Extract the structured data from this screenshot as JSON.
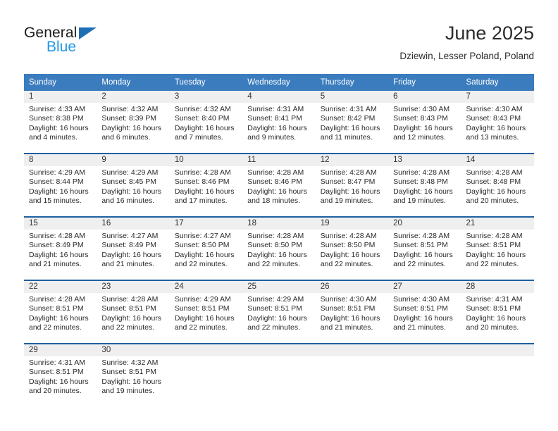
{
  "brand": {
    "line1": "General",
    "line2": "Blue",
    "triangle_color": "#1f6fb5",
    "blue_text_color": "#2196e3"
  },
  "header": {
    "title": "June 2025",
    "subtitle": "Dziewin, Lesser Poland, Poland"
  },
  "colors": {
    "header_band": "#3a7cbe",
    "row_divider": "#1f5fa0",
    "daynum_band": "#efefef",
    "text": "#2a2a2a"
  },
  "weekdays": [
    "Sunday",
    "Monday",
    "Tuesday",
    "Wednesday",
    "Thursday",
    "Friday",
    "Saturday"
  ],
  "labels": {
    "sunrise_prefix": "Sunrise:",
    "sunset_prefix": "Sunset:",
    "daylight_prefix": "Daylight:"
  },
  "weeks": [
    [
      {
        "day": "1",
        "sunrise": "Sunrise: 4:33 AM",
        "sunset": "Sunset: 8:38 PM",
        "daylight": "Daylight: 16 hours and 4 minutes."
      },
      {
        "day": "2",
        "sunrise": "Sunrise: 4:32 AM",
        "sunset": "Sunset: 8:39 PM",
        "daylight": "Daylight: 16 hours and 6 minutes."
      },
      {
        "day": "3",
        "sunrise": "Sunrise: 4:32 AM",
        "sunset": "Sunset: 8:40 PM",
        "daylight": "Daylight: 16 hours and 7 minutes."
      },
      {
        "day": "4",
        "sunrise": "Sunrise: 4:31 AM",
        "sunset": "Sunset: 8:41 PM",
        "daylight": "Daylight: 16 hours and 9 minutes."
      },
      {
        "day": "5",
        "sunrise": "Sunrise: 4:31 AM",
        "sunset": "Sunset: 8:42 PM",
        "daylight": "Daylight: 16 hours and 11 minutes."
      },
      {
        "day": "6",
        "sunrise": "Sunrise: 4:30 AM",
        "sunset": "Sunset: 8:43 PM",
        "daylight": "Daylight: 16 hours and 12 minutes."
      },
      {
        "day": "7",
        "sunrise": "Sunrise: 4:30 AM",
        "sunset": "Sunset: 8:43 PM",
        "daylight": "Daylight: 16 hours and 13 minutes."
      }
    ],
    [
      {
        "day": "8",
        "sunrise": "Sunrise: 4:29 AM",
        "sunset": "Sunset: 8:44 PM",
        "daylight": "Daylight: 16 hours and 15 minutes."
      },
      {
        "day": "9",
        "sunrise": "Sunrise: 4:29 AM",
        "sunset": "Sunset: 8:45 PM",
        "daylight": "Daylight: 16 hours and 16 minutes."
      },
      {
        "day": "10",
        "sunrise": "Sunrise: 4:28 AM",
        "sunset": "Sunset: 8:46 PM",
        "daylight": "Daylight: 16 hours and 17 minutes."
      },
      {
        "day": "11",
        "sunrise": "Sunrise: 4:28 AM",
        "sunset": "Sunset: 8:46 PM",
        "daylight": "Daylight: 16 hours and 18 minutes."
      },
      {
        "day": "12",
        "sunrise": "Sunrise: 4:28 AM",
        "sunset": "Sunset: 8:47 PM",
        "daylight": "Daylight: 16 hours and 19 minutes."
      },
      {
        "day": "13",
        "sunrise": "Sunrise: 4:28 AM",
        "sunset": "Sunset: 8:48 PM",
        "daylight": "Daylight: 16 hours and 19 minutes."
      },
      {
        "day": "14",
        "sunrise": "Sunrise: 4:28 AM",
        "sunset": "Sunset: 8:48 PM",
        "daylight": "Daylight: 16 hours and 20 minutes."
      }
    ],
    [
      {
        "day": "15",
        "sunrise": "Sunrise: 4:28 AM",
        "sunset": "Sunset: 8:49 PM",
        "daylight": "Daylight: 16 hours and 21 minutes."
      },
      {
        "day": "16",
        "sunrise": "Sunrise: 4:27 AM",
        "sunset": "Sunset: 8:49 PM",
        "daylight": "Daylight: 16 hours and 21 minutes."
      },
      {
        "day": "17",
        "sunrise": "Sunrise: 4:27 AM",
        "sunset": "Sunset: 8:50 PM",
        "daylight": "Daylight: 16 hours and 22 minutes."
      },
      {
        "day": "18",
        "sunrise": "Sunrise: 4:28 AM",
        "sunset": "Sunset: 8:50 PM",
        "daylight": "Daylight: 16 hours and 22 minutes."
      },
      {
        "day": "19",
        "sunrise": "Sunrise: 4:28 AM",
        "sunset": "Sunset: 8:50 PM",
        "daylight": "Daylight: 16 hours and 22 minutes."
      },
      {
        "day": "20",
        "sunrise": "Sunrise: 4:28 AM",
        "sunset": "Sunset: 8:51 PM",
        "daylight": "Daylight: 16 hours and 22 minutes."
      },
      {
        "day": "21",
        "sunrise": "Sunrise: 4:28 AM",
        "sunset": "Sunset: 8:51 PM",
        "daylight": "Daylight: 16 hours and 22 minutes."
      }
    ],
    [
      {
        "day": "22",
        "sunrise": "Sunrise: 4:28 AM",
        "sunset": "Sunset: 8:51 PM",
        "daylight": "Daylight: 16 hours and 22 minutes."
      },
      {
        "day": "23",
        "sunrise": "Sunrise: 4:28 AM",
        "sunset": "Sunset: 8:51 PM",
        "daylight": "Daylight: 16 hours and 22 minutes."
      },
      {
        "day": "24",
        "sunrise": "Sunrise: 4:29 AM",
        "sunset": "Sunset: 8:51 PM",
        "daylight": "Daylight: 16 hours and 22 minutes."
      },
      {
        "day": "25",
        "sunrise": "Sunrise: 4:29 AM",
        "sunset": "Sunset: 8:51 PM",
        "daylight": "Daylight: 16 hours and 22 minutes."
      },
      {
        "day": "26",
        "sunrise": "Sunrise: 4:30 AM",
        "sunset": "Sunset: 8:51 PM",
        "daylight": "Daylight: 16 hours and 21 minutes."
      },
      {
        "day": "27",
        "sunrise": "Sunrise: 4:30 AM",
        "sunset": "Sunset: 8:51 PM",
        "daylight": "Daylight: 16 hours and 21 minutes."
      },
      {
        "day": "28",
        "sunrise": "Sunrise: 4:31 AM",
        "sunset": "Sunset: 8:51 PM",
        "daylight": "Daylight: 16 hours and 20 minutes."
      }
    ],
    [
      {
        "day": "29",
        "sunrise": "Sunrise: 4:31 AM",
        "sunset": "Sunset: 8:51 PM",
        "daylight": "Daylight: 16 hours and 20 minutes."
      },
      {
        "day": "30",
        "sunrise": "Sunrise: 4:32 AM",
        "sunset": "Sunset: 8:51 PM",
        "daylight": "Daylight: 16 hours and 19 minutes."
      },
      {
        "day": "",
        "sunrise": "",
        "sunset": "",
        "daylight": ""
      },
      {
        "day": "",
        "sunrise": "",
        "sunset": "",
        "daylight": ""
      },
      {
        "day": "",
        "sunrise": "",
        "sunset": "",
        "daylight": ""
      },
      {
        "day": "",
        "sunrise": "",
        "sunset": "",
        "daylight": ""
      },
      {
        "day": "",
        "sunrise": "",
        "sunset": "",
        "daylight": ""
      }
    ]
  ]
}
